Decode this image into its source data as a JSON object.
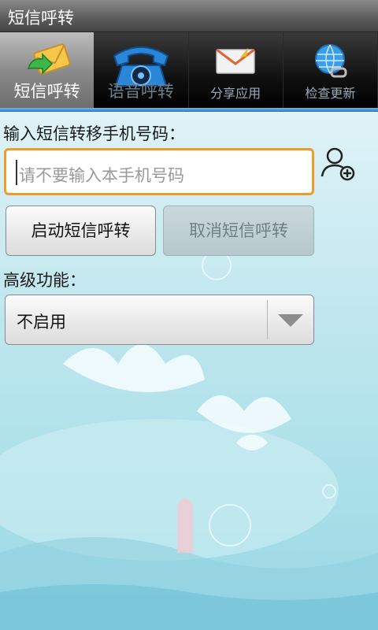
{
  "title": "短信呼转",
  "tabs": [
    {
      "label": "短信呼转",
      "icon": "sms-envelope-icon",
      "active": true
    },
    {
      "label": "语音呼转",
      "icon": "telephone-icon",
      "active": false
    },
    {
      "label": "分享应用",
      "icon": "share-envelope-icon",
      "active": false
    },
    {
      "label": "检查更新",
      "icon": "globe-update-icon",
      "active": false
    }
  ],
  "form": {
    "phone_label": "输入短信转移手机号码：",
    "phone_value": "",
    "phone_placeholder": "请不要输入本手机号码",
    "start_label": "启动短信呼转",
    "cancel_label": "取消短信呼转",
    "advanced_label": "高级功能：",
    "advanced_selected": "不启用"
  },
  "colors": {
    "accent_orange": "#f09a2a",
    "tab_underline": "#2a78c0",
    "content_bg": "#bfe6ee"
  }
}
